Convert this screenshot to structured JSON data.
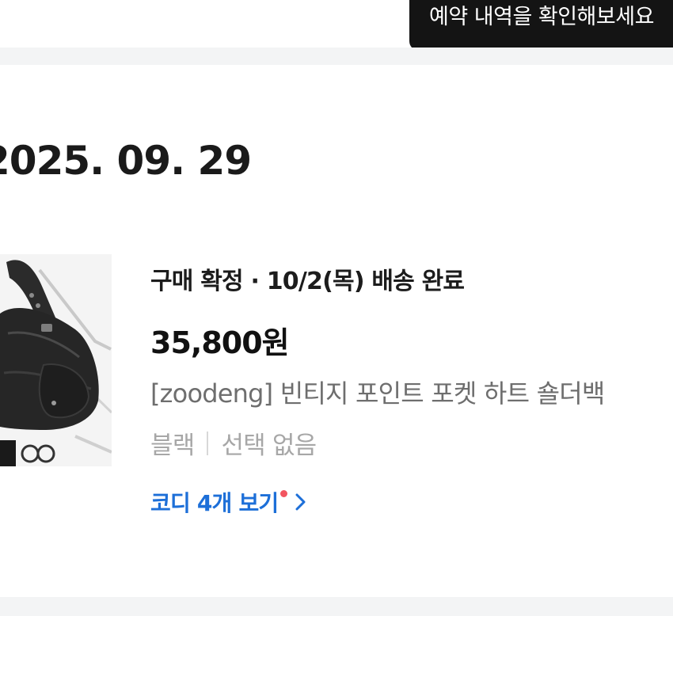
{
  "tooltip": {
    "text": "예약 내역을 확인해보세요"
  },
  "order": {
    "date": "2025. 09. 29",
    "status": "구매 확정 · 10/2(목) 배송 완료",
    "price": "35,800원",
    "product_name": "[zoodeng] 빈티지 포인트 포켓 하트 숄더백",
    "option_color": "블랙",
    "option_extra": "선택 없음",
    "codi_link_label": "코디 4개 보기",
    "thumbnail_icon": "product-photo"
  },
  "colors": {
    "link_blue": "#1d6fd8",
    "notification_dot": "#f25560",
    "tooltip_bg": "#141414"
  }
}
